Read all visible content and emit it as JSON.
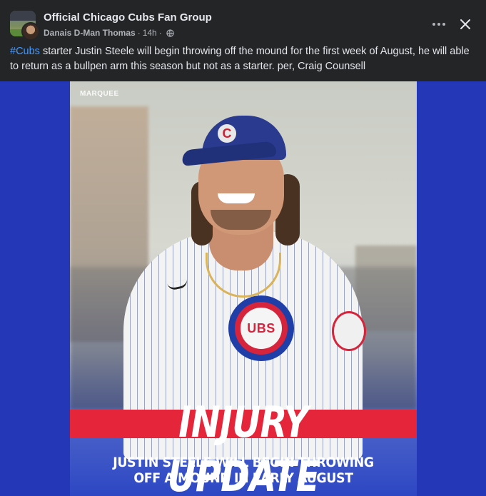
{
  "post": {
    "group_name": "Official Chicago Cubs Fan Group",
    "author": "Danais D-Man Thomas",
    "time": "14h",
    "separator": "·",
    "privacy_icon": "globe-icon",
    "more_icon": "more-options-icon",
    "close_icon": "close-icon",
    "hashtag": "#Cubs",
    "body_text": " starter Justin Steele will begin throwing off the mound for the first week of August, he will able to return as a bullpen arm this season but not as a starter. per, Craig Counsell"
  },
  "graphic": {
    "brand": "MARQUEE",
    "cap_letter": "C",
    "jersey_logo": "UBS",
    "headline": "INJURY UPDATE",
    "subhead_line1": "JUSTIN STEELE WILL BEGIN THROWING",
    "subhead_line2": "OFF A MOUND IN EARLY AUGUST"
  },
  "colors": {
    "background": "#242526",
    "media_bg": "#2437b6",
    "link": "#4599ff",
    "accent_red": "#e4253a"
  }
}
